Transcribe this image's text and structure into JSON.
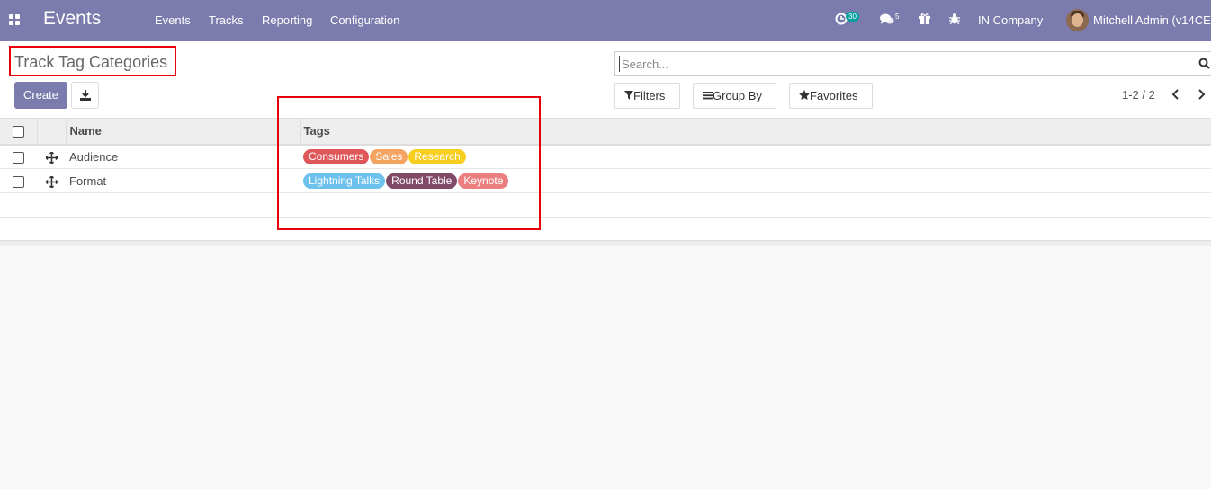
{
  "navbar": {
    "app_title": "Events",
    "menu": [
      "Events",
      "Tracks",
      "Reporting",
      "Configuration"
    ],
    "activity_count": "30",
    "messages_count": "5",
    "company": "IN Company",
    "user": "Mitchell Admin (v14CE"
  },
  "control_panel": {
    "breadcrumb": "Track Tag Categories",
    "create_label": "Create",
    "search_placeholder": "Search...",
    "filters_label": "Filters",
    "group_by_label": "Group By",
    "favorites_label": "Favorites",
    "pager": "1-2 / 2"
  },
  "table": {
    "columns": {
      "name": "Name",
      "tags": "Tags"
    },
    "rows": [
      {
        "name": "Audience",
        "tags": [
          {
            "label": "Consumers",
            "color": "#e0575a"
          },
          {
            "label": "Sales",
            "color": "#f4a460"
          },
          {
            "label": "Research",
            "color": "#f7cd1f"
          }
        ]
      },
      {
        "name": "Format",
        "tags": [
          {
            "label": "Lightning Talks",
            "color": "#6cc1ed"
          },
          {
            "label": "Round Table",
            "color": "#814968"
          },
          {
            "label": "Keynote",
            "color": "#eb7e7f"
          }
        ]
      }
    ]
  },
  "colors": {
    "primary": "#7c7bad",
    "highlight": "#e8000b"
  }
}
